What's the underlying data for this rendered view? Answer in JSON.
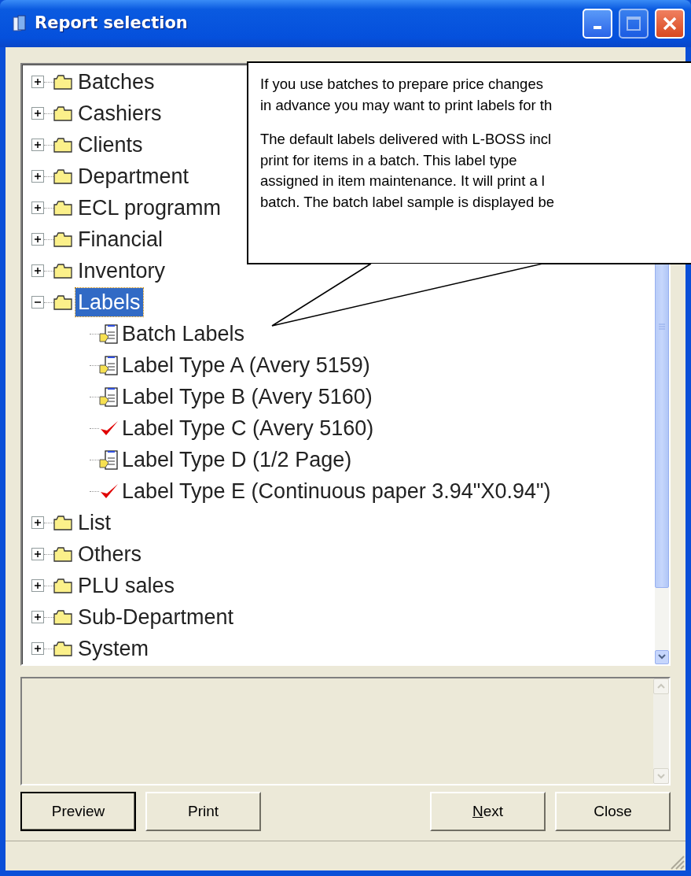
{
  "window": {
    "title": "Report selection"
  },
  "tree": [
    {
      "label": "Batches",
      "expanded": false,
      "selected": false
    },
    {
      "label": "Cashiers",
      "expanded": false,
      "selected": false
    },
    {
      "label": "Clients",
      "expanded": false,
      "selected": false
    },
    {
      "label": "Department",
      "expanded": false,
      "selected": false
    },
    {
      "label": "ECL programm",
      "expanded": false,
      "selected": false
    },
    {
      "label": "Financial",
      "expanded": false,
      "selected": false
    },
    {
      "label": "Inventory",
      "expanded": false,
      "selected": false
    },
    {
      "label": "Labels",
      "expanded": true,
      "selected": true,
      "children": [
        {
          "label": "Batch Labels",
          "kind": "report",
          "selected": false
        },
        {
          "label": "Label Type A (Avery 5159)",
          "kind": "report",
          "selected": false
        },
        {
          "label": "Label Type B (Avery 5160)",
          "kind": "report",
          "selected": false
        },
        {
          "label": "Label Type C (Avery 5160)",
          "kind": "checked",
          "selected": false
        },
        {
          "label": "Label Type D (1/2 Page)",
          "kind": "report",
          "selected": false
        },
        {
          "label": "Label Type E (Continuous paper 3.94\"X0.94\")",
          "kind": "checked",
          "selected": false
        }
      ]
    },
    {
      "label": "List",
      "expanded": false,
      "selected": false
    },
    {
      "label": "Others",
      "expanded": false,
      "selected": false
    },
    {
      "label": "PLU sales",
      "expanded": false,
      "selected": false
    },
    {
      "label": "Sub-Department",
      "expanded": false,
      "selected": false
    },
    {
      "label": "System",
      "expanded": false,
      "selected": false
    }
  ],
  "callout": {
    "paragraphs": [
      [
        "If you use batches to prepare price changes",
        "in advance you may want to print labels for th"
      ],
      [
        "The default labels delivered with L-BOSS incl",
        "print for items in a batch. This label type",
        "assigned in item maintenance. It will print a l",
        "batch. The batch label sample is displayed be"
      ]
    ]
  },
  "buttons_left": [
    {
      "label": "Preview",
      "default": true,
      "underline_first": false
    },
    {
      "label": "Print",
      "default": false,
      "underline_first": false
    }
  ],
  "buttons_right": [
    {
      "label": "Next",
      "default": false,
      "underline_first": true
    },
    {
      "label": "Close",
      "default": false,
      "underline_first": false
    }
  ]
}
